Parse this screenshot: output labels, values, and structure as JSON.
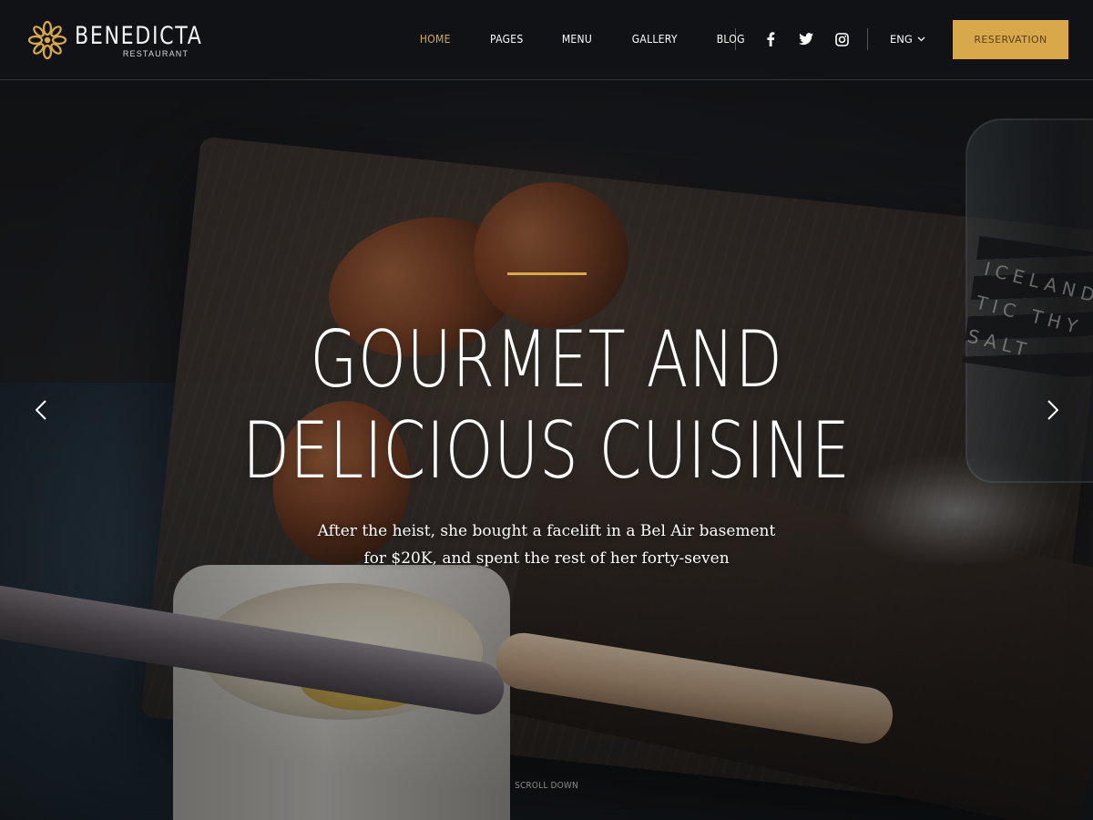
{
  "brand": {
    "name": "BENEDICTA",
    "subtitle": "RESTAURANT",
    "logo_icon": "flower-logo-icon",
    "accent_color": "#d9a84b"
  },
  "nav": {
    "items": [
      {
        "label": "HOME",
        "active": true
      },
      {
        "label": "PAGES",
        "active": false
      },
      {
        "label": "MENU",
        "active": false
      },
      {
        "label": "GALLERY",
        "active": false
      },
      {
        "label": "BLOG",
        "active": false
      }
    ]
  },
  "social": {
    "icons": [
      "facebook-icon",
      "twitter-icon",
      "instagram-icon"
    ]
  },
  "language": {
    "selected": "ENG",
    "icon": "chevron-down-icon"
  },
  "reservation": {
    "label": "RESERVATION",
    "bg_color": "#d9a84b"
  },
  "hero": {
    "title_line1": "GOURMET AND",
    "title_line2": "DELICIOUS CUISINE",
    "subtitle_line1": "After the heist, she bought a facelift in a Bel Air basement",
    "subtitle_line2": "for $20K, and spent the rest of her forty-seven",
    "prev_icon": "chevron-left-icon",
    "next_icon": "chevron-right-icon",
    "scroll_label": "SCROLL DOWN"
  }
}
